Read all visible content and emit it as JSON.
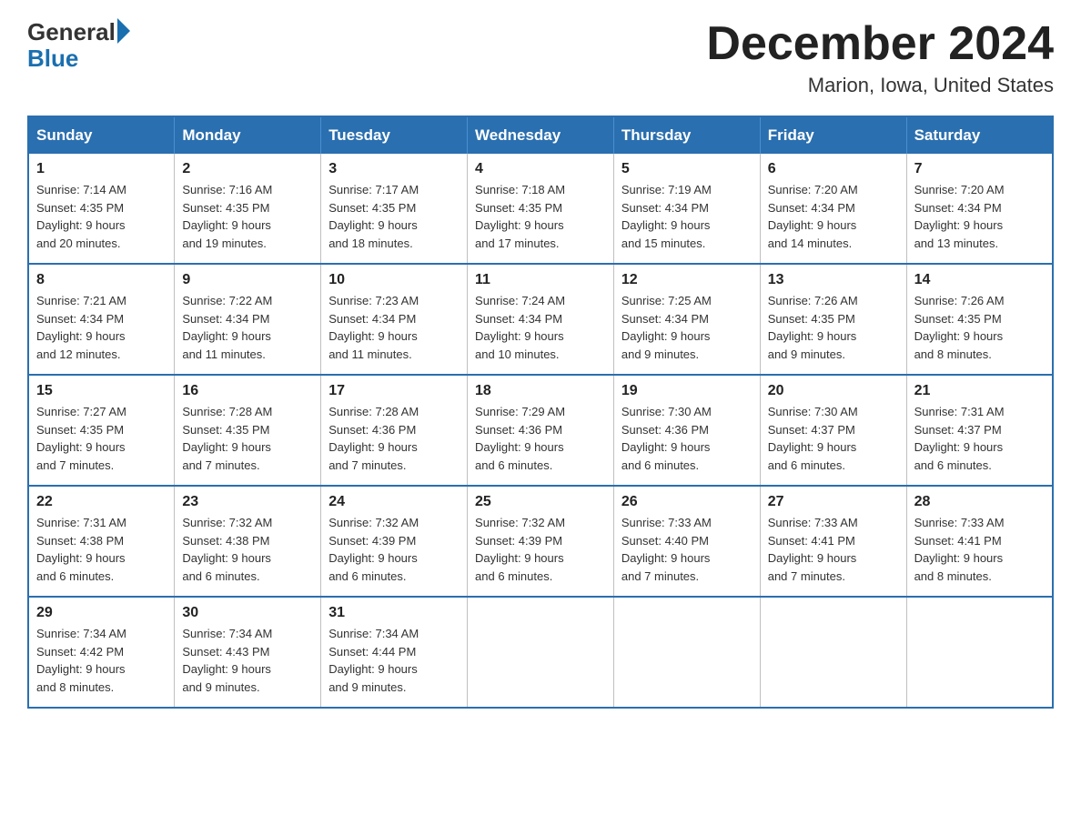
{
  "logo": {
    "general": "General",
    "blue": "Blue"
  },
  "title": "December 2024",
  "location": "Marion, Iowa, United States",
  "days_of_week": [
    "Sunday",
    "Monday",
    "Tuesday",
    "Wednesday",
    "Thursday",
    "Friday",
    "Saturday"
  ],
  "weeks": [
    [
      {
        "day": "1",
        "sunrise": "7:14 AM",
        "sunset": "4:35 PM",
        "daylight": "9 hours and 20 minutes."
      },
      {
        "day": "2",
        "sunrise": "7:16 AM",
        "sunset": "4:35 PM",
        "daylight": "9 hours and 19 minutes."
      },
      {
        "day": "3",
        "sunrise": "7:17 AM",
        "sunset": "4:35 PM",
        "daylight": "9 hours and 18 minutes."
      },
      {
        "day": "4",
        "sunrise": "7:18 AM",
        "sunset": "4:35 PM",
        "daylight": "9 hours and 17 minutes."
      },
      {
        "day": "5",
        "sunrise": "7:19 AM",
        "sunset": "4:34 PM",
        "daylight": "9 hours and 15 minutes."
      },
      {
        "day": "6",
        "sunrise": "7:20 AM",
        "sunset": "4:34 PM",
        "daylight": "9 hours and 14 minutes."
      },
      {
        "day": "7",
        "sunrise": "7:20 AM",
        "sunset": "4:34 PM",
        "daylight": "9 hours and 13 minutes."
      }
    ],
    [
      {
        "day": "8",
        "sunrise": "7:21 AM",
        "sunset": "4:34 PM",
        "daylight": "9 hours and 12 minutes."
      },
      {
        "day": "9",
        "sunrise": "7:22 AM",
        "sunset": "4:34 PM",
        "daylight": "9 hours and 11 minutes."
      },
      {
        "day": "10",
        "sunrise": "7:23 AM",
        "sunset": "4:34 PM",
        "daylight": "9 hours and 11 minutes."
      },
      {
        "day": "11",
        "sunrise": "7:24 AM",
        "sunset": "4:34 PM",
        "daylight": "9 hours and 10 minutes."
      },
      {
        "day": "12",
        "sunrise": "7:25 AM",
        "sunset": "4:34 PM",
        "daylight": "9 hours and 9 minutes."
      },
      {
        "day": "13",
        "sunrise": "7:26 AM",
        "sunset": "4:35 PM",
        "daylight": "9 hours and 9 minutes."
      },
      {
        "day": "14",
        "sunrise": "7:26 AM",
        "sunset": "4:35 PM",
        "daylight": "9 hours and 8 minutes."
      }
    ],
    [
      {
        "day": "15",
        "sunrise": "7:27 AM",
        "sunset": "4:35 PM",
        "daylight": "9 hours and 7 minutes."
      },
      {
        "day": "16",
        "sunrise": "7:28 AM",
        "sunset": "4:35 PM",
        "daylight": "9 hours and 7 minutes."
      },
      {
        "day": "17",
        "sunrise": "7:28 AM",
        "sunset": "4:36 PM",
        "daylight": "9 hours and 7 minutes."
      },
      {
        "day": "18",
        "sunrise": "7:29 AM",
        "sunset": "4:36 PM",
        "daylight": "9 hours and 6 minutes."
      },
      {
        "day": "19",
        "sunrise": "7:30 AM",
        "sunset": "4:36 PM",
        "daylight": "9 hours and 6 minutes."
      },
      {
        "day": "20",
        "sunrise": "7:30 AM",
        "sunset": "4:37 PM",
        "daylight": "9 hours and 6 minutes."
      },
      {
        "day": "21",
        "sunrise": "7:31 AM",
        "sunset": "4:37 PM",
        "daylight": "9 hours and 6 minutes."
      }
    ],
    [
      {
        "day": "22",
        "sunrise": "7:31 AM",
        "sunset": "4:38 PM",
        "daylight": "9 hours and 6 minutes."
      },
      {
        "day": "23",
        "sunrise": "7:32 AM",
        "sunset": "4:38 PM",
        "daylight": "9 hours and 6 minutes."
      },
      {
        "day": "24",
        "sunrise": "7:32 AM",
        "sunset": "4:39 PM",
        "daylight": "9 hours and 6 minutes."
      },
      {
        "day": "25",
        "sunrise": "7:32 AM",
        "sunset": "4:39 PM",
        "daylight": "9 hours and 6 minutes."
      },
      {
        "day": "26",
        "sunrise": "7:33 AM",
        "sunset": "4:40 PM",
        "daylight": "9 hours and 7 minutes."
      },
      {
        "day": "27",
        "sunrise": "7:33 AM",
        "sunset": "4:41 PM",
        "daylight": "9 hours and 7 minutes."
      },
      {
        "day": "28",
        "sunrise": "7:33 AM",
        "sunset": "4:41 PM",
        "daylight": "9 hours and 8 minutes."
      }
    ],
    [
      {
        "day": "29",
        "sunrise": "7:34 AM",
        "sunset": "4:42 PM",
        "daylight": "9 hours and 8 minutes."
      },
      {
        "day": "30",
        "sunrise": "7:34 AM",
        "sunset": "4:43 PM",
        "daylight": "9 hours and 9 minutes."
      },
      {
        "day": "31",
        "sunrise": "7:34 AM",
        "sunset": "4:44 PM",
        "daylight": "9 hours and 9 minutes."
      },
      null,
      null,
      null,
      null
    ]
  ],
  "labels": {
    "sunrise": "Sunrise:",
    "sunset": "Sunset:",
    "daylight": "Daylight:"
  }
}
